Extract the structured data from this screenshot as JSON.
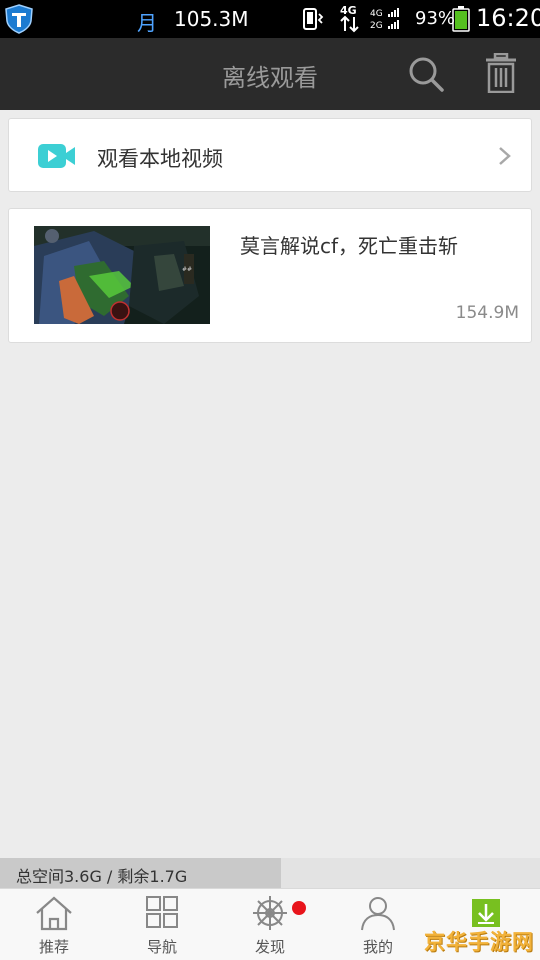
{
  "status_bar": {
    "moon_glyph": "月",
    "traffic": "105.3M",
    "network": "4G",
    "battery_percent": "93%",
    "time": "16:20",
    "colors": {
      "background": "#000000",
      "moon": "#4fa3ff",
      "battery": "#55c020"
    }
  },
  "header": {
    "title": "离线观看",
    "search_icon": "search-icon",
    "trash_icon": "trash-icon"
  },
  "local_video": {
    "label": "观看本地视频",
    "icon": "video-camera-icon",
    "accent": "#3ccfd4"
  },
  "videos": [
    {
      "title": "莫言解说cf，死亡重击斩",
      "size": "154.9M"
    }
  ],
  "storage": {
    "text": "总空间3.6G / 剩余1.7G",
    "used_fraction": 0.52
  },
  "tabs": [
    {
      "label": "推荐",
      "icon": "home-icon"
    },
    {
      "label": "导航",
      "icon": "grid-icon"
    },
    {
      "label": "发现",
      "icon": "helm-wheel-icon",
      "badge": true
    },
    {
      "label": "我的",
      "icon": "user-icon"
    },
    {
      "label": "",
      "icon": "download-icon",
      "accent": "#78c020"
    }
  ],
  "watermark": "京华手游网"
}
